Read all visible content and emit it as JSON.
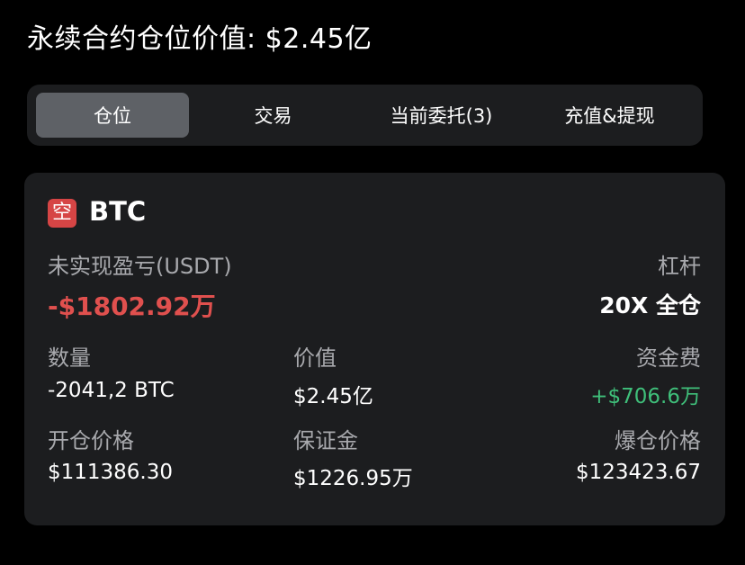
{
  "header": {
    "title": "永续合约仓位价值: $2.45亿"
  },
  "tabs": [
    {
      "label": "仓位",
      "active": true
    },
    {
      "label": "交易",
      "active": false
    },
    {
      "label": "当前委托(3)",
      "active": false
    },
    {
      "label": "充值&提现",
      "active": false
    }
  ],
  "position": {
    "side_badge": "空",
    "symbol": "BTC",
    "pnl_label": "未实现盈亏(USDT)",
    "pnl_value": "-$1802.92万",
    "leverage_label": "杠杆",
    "leverage_value": "20X 全仓",
    "quantity_label": "数量",
    "quantity_value": "-2041,2 BTC",
    "value_label": "价值",
    "value_value": "$2.45亿",
    "funding_label": "资金费",
    "funding_value": "+$706.6万",
    "entry_label": "开仓价格",
    "entry_value": "$111386.30",
    "margin_label": "保证金",
    "margin_value": "$1226.95万",
    "liq_label": "爆仓价格",
    "liq_value": "$123423.67"
  },
  "colors": {
    "background": "#000000",
    "card": "#1c1d1f",
    "tab_active": "#5e6166",
    "short_badge": "#d64545",
    "loss": "#e0504e",
    "gain": "#3fbf7a",
    "muted_text": "#a8a9ad"
  }
}
